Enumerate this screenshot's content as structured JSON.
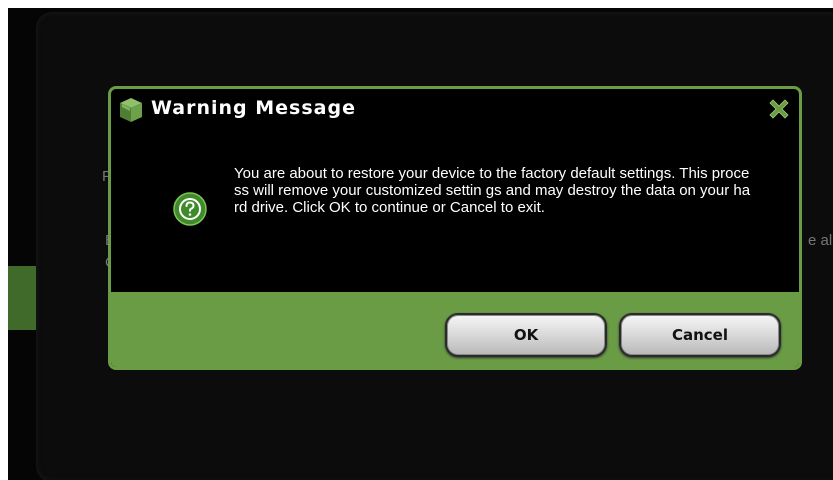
{
  "background": {
    "peek_texts": [
      "F",
      "E",
      "C",
      "e al"
    ]
  },
  "dialog": {
    "title": "Warning Message",
    "message": "You are about to restore your device to the factory default settings. This process will remove your customized settin gs and may destroy the data on your hard drive. Click OK to continue or Cancel to exit.",
    "icons": {
      "logo": "cube-logo-icon",
      "close": "close-icon",
      "message": "question-icon"
    },
    "buttons": {
      "ok_label": "OK",
      "cancel_label": "Cancel"
    }
  },
  "colors": {
    "accent_green": "#6a9b45",
    "dialog_background": "#000000",
    "text": "#ffffff"
  }
}
